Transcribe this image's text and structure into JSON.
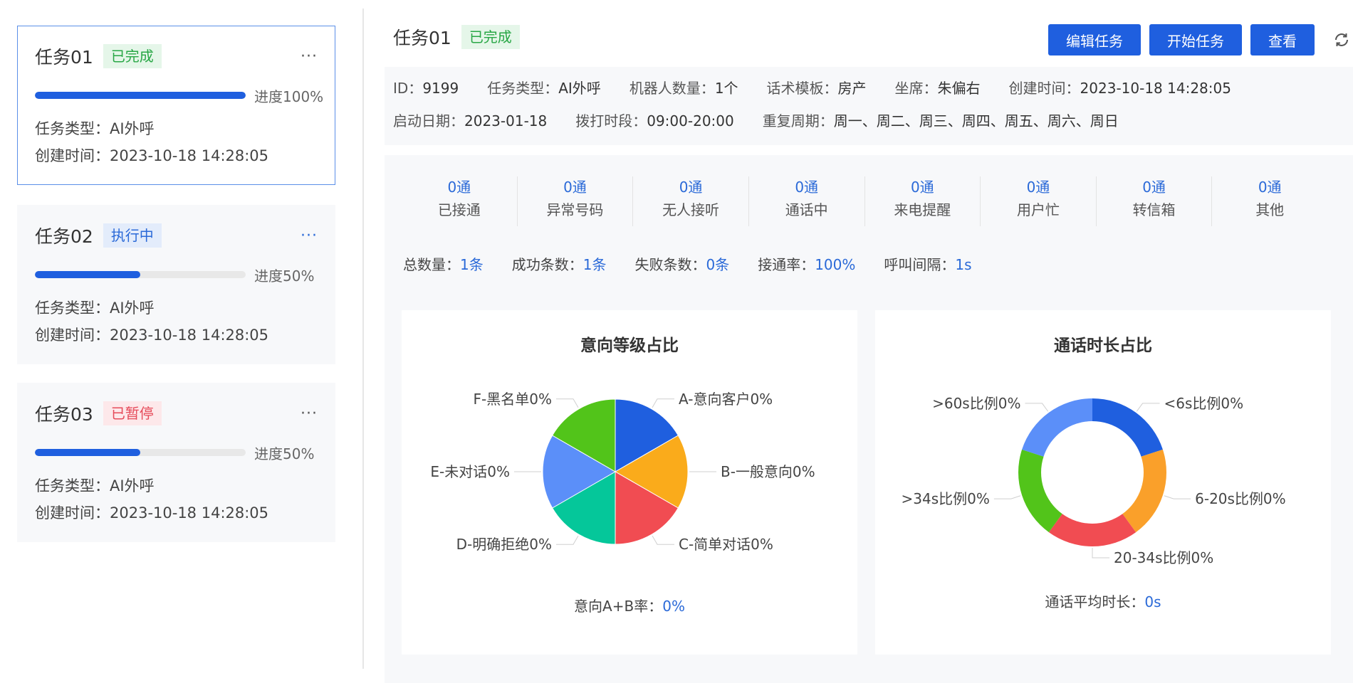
{
  "tasks": [
    {
      "name": "任务01",
      "status": "已完成",
      "progress_label": "进度100%",
      "progress": 1.0,
      "type_label": "任务类型：",
      "type": "AI外呼",
      "created_label": "创建时间：",
      "created": "2023-10-18  14:28:05"
    },
    {
      "name": "任务02",
      "status": "执行中",
      "progress_label": "进度50%",
      "progress": 0.5,
      "type_label": "任务类型：",
      "type": "AI外呼",
      "created_label": "创建时间：",
      "created": "2023-10-18  14:28:05"
    },
    {
      "name": "任务03",
      "status": "已暂停",
      "progress_label": "进度50%",
      "progress": 0.5,
      "type_label": "任务类型：",
      "type": "AI外呼",
      "created_label": "创建时间：",
      "created": "2023-10-18  14:28:05"
    }
  ],
  "more_icon": "···",
  "header": {
    "title": "任务01",
    "status": "已完成",
    "buttons": {
      "edit": "编辑任务",
      "start": "开始任务",
      "view": "查看"
    }
  },
  "info": {
    "row1": [
      {
        "label": "ID：",
        "value": "9199"
      },
      {
        "label": "任务类型：",
        "value": "AI外呼"
      },
      {
        "label": "机器人数量：",
        "value": "1个"
      },
      {
        "label": "话术模板：",
        "value": "房产"
      },
      {
        "label": "坐席：",
        "value": "朱偏右"
      },
      {
        "label": "创建时间：",
        "value": "2023-10-18 14:28:05"
      }
    ],
    "row2": [
      {
        "label": "启动日期：",
        "value": "2023-01-18"
      },
      {
        "label": "拨打时段：",
        "value": "09:00-20:00"
      },
      {
        "label": "重复周期：",
        "value": "周一、周二、周三、周四、周五、周六、周日"
      }
    ]
  },
  "counters": [
    {
      "value": "0通",
      "label": "已接通"
    },
    {
      "value": "0通",
      "label": "异常号码"
    },
    {
      "value": "0通",
      "label": "无人接听"
    },
    {
      "value": "0通",
      "label": "通话中"
    },
    {
      "value": "0通",
      "label": "来电提醒"
    },
    {
      "value": "0通",
      "label": "用户忙"
    },
    {
      "value": "0通",
      "label": "转信箱"
    },
    {
      "value": "0通",
      "label": "其他"
    }
  ],
  "summary": [
    {
      "label": "总数量：",
      "value": "1条"
    },
    {
      "label": "成功条数：",
      "value": "1条"
    },
    {
      "label": "失败条数：",
      "value": "0条"
    },
    {
      "label": "接通率：",
      "value": "100%"
    },
    {
      "label": "呼叫间隔：",
      "value": "1s"
    }
  ],
  "chart_data": [
    {
      "type": "pie",
      "title": "意向等级占比",
      "categories": [
        "A-意向客户0%",
        "B-一般意向0%",
        "C-简单对话0%",
        "D-明确拒绝0%",
        "E-未对话0%",
        "F-黑名单0%"
      ],
      "values": [
        1,
        1,
        1,
        1,
        1,
        1
      ],
      "colors": [
        "#1f5fdf",
        "#faab1b",
        "#f14c52",
        "#05c79a",
        "#5b8ff9",
        "#52c41a"
      ],
      "footer_label": "意向A+B率：",
      "footer_value": "0%"
    },
    {
      "type": "pie",
      "title": "通话时长占比",
      "categories": [
        "<6s比例0%",
        "6-20s比例0%",
        "20-34s比例0%",
        ">34s比例0%",
        ">60s比例0%"
      ],
      "values": [
        1,
        1,
        1,
        1,
        1
      ],
      "colors": [
        "#1f5fdf",
        "#faa02a",
        "#f14c52",
        "#52c41a",
        "#5b8ff9"
      ],
      "footer_label": "通话平均时长：",
      "footer_value": "0s"
    }
  ]
}
